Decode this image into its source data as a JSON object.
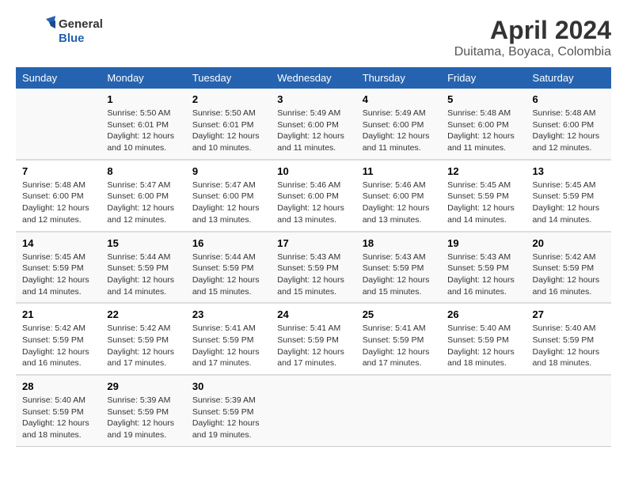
{
  "header": {
    "logo_line1": "General",
    "logo_line2": "Blue",
    "month_year": "April 2024",
    "location": "Duitama, Boyaca, Colombia"
  },
  "weekdays": [
    "Sunday",
    "Monday",
    "Tuesday",
    "Wednesday",
    "Thursday",
    "Friday",
    "Saturday"
  ],
  "weeks": [
    [
      {
        "day": "",
        "sunrise": "",
        "sunset": "",
        "daylight": ""
      },
      {
        "day": "1",
        "sunrise": "Sunrise: 5:50 AM",
        "sunset": "Sunset: 6:01 PM",
        "daylight": "Daylight: 12 hours and 10 minutes."
      },
      {
        "day": "2",
        "sunrise": "Sunrise: 5:50 AM",
        "sunset": "Sunset: 6:01 PM",
        "daylight": "Daylight: 12 hours and 10 minutes."
      },
      {
        "day": "3",
        "sunrise": "Sunrise: 5:49 AM",
        "sunset": "Sunset: 6:00 PM",
        "daylight": "Daylight: 12 hours and 11 minutes."
      },
      {
        "day": "4",
        "sunrise": "Sunrise: 5:49 AM",
        "sunset": "Sunset: 6:00 PM",
        "daylight": "Daylight: 12 hours and 11 minutes."
      },
      {
        "day": "5",
        "sunrise": "Sunrise: 5:48 AM",
        "sunset": "Sunset: 6:00 PM",
        "daylight": "Daylight: 12 hours and 11 minutes."
      },
      {
        "day": "6",
        "sunrise": "Sunrise: 5:48 AM",
        "sunset": "Sunset: 6:00 PM",
        "daylight": "Daylight: 12 hours and 12 minutes."
      }
    ],
    [
      {
        "day": "7",
        "sunrise": "Sunrise: 5:48 AM",
        "sunset": "Sunset: 6:00 PM",
        "daylight": "Daylight: 12 hours and 12 minutes."
      },
      {
        "day": "8",
        "sunrise": "Sunrise: 5:47 AM",
        "sunset": "Sunset: 6:00 PM",
        "daylight": "Daylight: 12 hours and 12 minutes."
      },
      {
        "day": "9",
        "sunrise": "Sunrise: 5:47 AM",
        "sunset": "Sunset: 6:00 PM",
        "daylight": "Daylight: 12 hours and 13 minutes."
      },
      {
        "day": "10",
        "sunrise": "Sunrise: 5:46 AM",
        "sunset": "Sunset: 6:00 PM",
        "daylight": "Daylight: 12 hours and 13 minutes."
      },
      {
        "day": "11",
        "sunrise": "Sunrise: 5:46 AM",
        "sunset": "Sunset: 6:00 PM",
        "daylight": "Daylight: 12 hours and 13 minutes."
      },
      {
        "day": "12",
        "sunrise": "Sunrise: 5:45 AM",
        "sunset": "Sunset: 5:59 PM",
        "daylight": "Daylight: 12 hours and 14 minutes."
      },
      {
        "day": "13",
        "sunrise": "Sunrise: 5:45 AM",
        "sunset": "Sunset: 5:59 PM",
        "daylight": "Daylight: 12 hours and 14 minutes."
      }
    ],
    [
      {
        "day": "14",
        "sunrise": "Sunrise: 5:45 AM",
        "sunset": "Sunset: 5:59 PM",
        "daylight": "Daylight: 12 hours and 14 minutes."
      },
      {
        "day": "15",
        "sunrise": "Sunrise: 5:44 AM",
        "sunset": "Sunset: 5:59 PM",
        "daylight": "Daylight: 12 hours and 14 minutes."
      },
      {
        "day": "16",
        "sunrise": "Sunrise: 5:44 AM",
        "sunset": "Sunset: 5:59 PM",
        "daylight": "Daylight: 12 hours and 15 minutes."
      },
      {
        "day": "17",
        "sunrise": "Sunrise: 5:43 AM",
        "sunset": "Sunset: 5:59 PM",
        "daylight": "Daylight: 12 hours and 15 minutes."
      },
      {
        "day": "18",
        "sunrise": "Sunrise: 5:43 AM",
        "sunset": "Sunset: 5:59 PM",
        "daylight": "Daylight: 12 hours and 15 minutes."
      },
      {
        "day": "19",
        "sunrise": "Sunrise: 5:43 AM",
        "sunset": "Sunset: 5:59 PM",
        "daylight": "Daylight: 12 hours and 16 minutes."
      },
      {
        "day": "20",
        "sunrise": "Sunrise: 5:42 AM",
        "sunset": "Sunset: 5:59 PM",
        "daylight": "Daylight: 12 hours and 16 minutes."
      }
    ],
    [
      {
        "day": "21",
        "sunrise": "Sunrise: 5:42 AM",
        "sunset": "Sunset: 5:59 PM",
        "daylight": "Daylight: 12 hours and 16 minutes."
      },
      {
        "day": "22",
        "sunrise": "Sunrise: 5:42 AM",
        "sunset": "Sunset: 5:59 PM",
        "daylight": "Daylight: 12 hours and 17 minutes."
      },
      {
        "day": "23",
        "sunrise": "Sunrise: 5:41 AM",
        "sunset": "Sunset: 5:59 PM",
        "daylight": "Daylight: 12 hours and 17 minutes."
      },
      {
        "day": "24",
        "sunrise": "Sunrise: 5:41 AM",
        "sunset": "Sunset: 5:59 PM",
        "daylight": "Daylight: 12 hours and 17 minutes."
      },
      {
        "day": "25",
        "sunrise": "Sunrise: 5:41 AM",
        "sunset": "Sunset: 5:59 PM",
        "daylight": "Daylight: 12 hours and 17 minutes."
      },
      {
        "day": "26",
        "sunrise": "Sunrise: 5:40 AM",
        "sunset": "Sunset: 5:59 PM",
        "daylight": "Daylight: 12 hours and 18 minutes."
      },
      {
        "day": "27",
        "sunrise": "Sunrise: 5:40 AM",
        "sunset": "Sunset: 5:59 PM",
        "daylight": "Daylight: 12 hours and 18 minutes."
      }
    ],
    [
      {
        "day": "28",
        "sunrise": "Sunrise: 5:40 AM",
        "sunset": "Sunset: 5:59 PM",
        "daylight": "Daylight: 12 hours and 18 minutes."
      },
      {
        "day": "29",
        "sunrise": "Sunrise: 5:39 AM",
        "sunset": "Sunset: 5:59 PM",
        "daylight": "Daylight: 12 hours and 19 minutes."
      },
      {
        "day": "30",
        "sunrise": "Sunrise: 5:39 AM",
        "sunset": "Sunset: 5:59 PM",
        "daylight": "Daylight: 12 hours and 19 minutes."
      },
      {
        "day": "",
        "sunrise": "",
        "sunset": "",
        "daylight": ""
      },
      {
        "day": "",
        "sunrise": "",
        "sunset": "",
        "daylight": ""
      },
      {
        "day": "",
        "sunrise": "",
        "sunset": "",
        "daylight": ""
      },
      {
        "day": "",
        "sunrise": "",
        "sunset": "",
        "daylight": ""
      }
    ]
  ]
}
